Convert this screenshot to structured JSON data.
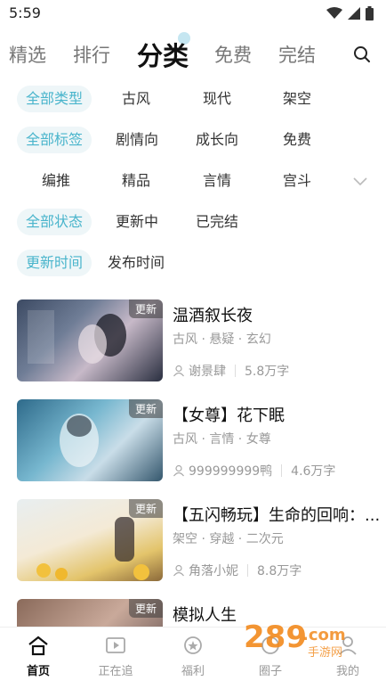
{
  "status": {
    "time": "5:59"
  },
  "top_tabs": [
    {
      "label": "精选"
    },
    {
      "label": "排行"
    },
    {
      "label": "分类"
    },
    {
      "label": "免费"
    },
    {
      "label": "完结"
    }
  ],
  "filters": {
    "type": [
      "全部类型",
      "古风",
      "现代",
      "架空"
    ],
    "tag_row1": [
      "全部标签",
      "剧情向",
      "成长向",
      "免费"
    ],
    "tag_row2": [
      "编推",
      "精品",
      "言情",
      "宫斗"
    ],
    "status": [
      "全部状态",
      "更新中",
      "已完结"
    ],
    "time": [
      "更新时间",
      "发布时间"
    ]
  },
  "books": [
    {
      "badge": "更新",
      "title": "温酒叙长夜",
      "tags": "古风 · 悬疑 · 玄幻",
      "author": "谢景肆",
      "words": "5.8万字"
    },
    {
      "badge": "更新",
      "title": "【女尊】花下眠",
      "tags": "古风 · 言情 · 女尊",
      "author": "999999999鸭",
      "words": "4.6万字"
    },
    {
      "badge": "更新",
      "title": "【五闪畅玩】生命的回响：...",
      "tags": "架空 · 穿越 · 二次元",
      "author": "角落小妮",
      "words": "8.8万字"
    },
    {
      "badge": "更新",
      "title": "模拟人生",
      "tags": "",
      "author": "",
      "words": ""
    }
  ],
  "bottom_nav": [
    {
      "label": "首页"
    },
    {
      "label": "正在追"
    },
    {
      "label": "福利"
    },
    {
      "label": "圈子"
    },
    {
      "label": "我的"
    }
  ],
  "watermark": {
    "text": "289.com",
    "sub": "手游网"
  },
  "colors": {
    "accent": "#4ab5cc",
    "chip_bg": "#eef6f8"
  }
}
